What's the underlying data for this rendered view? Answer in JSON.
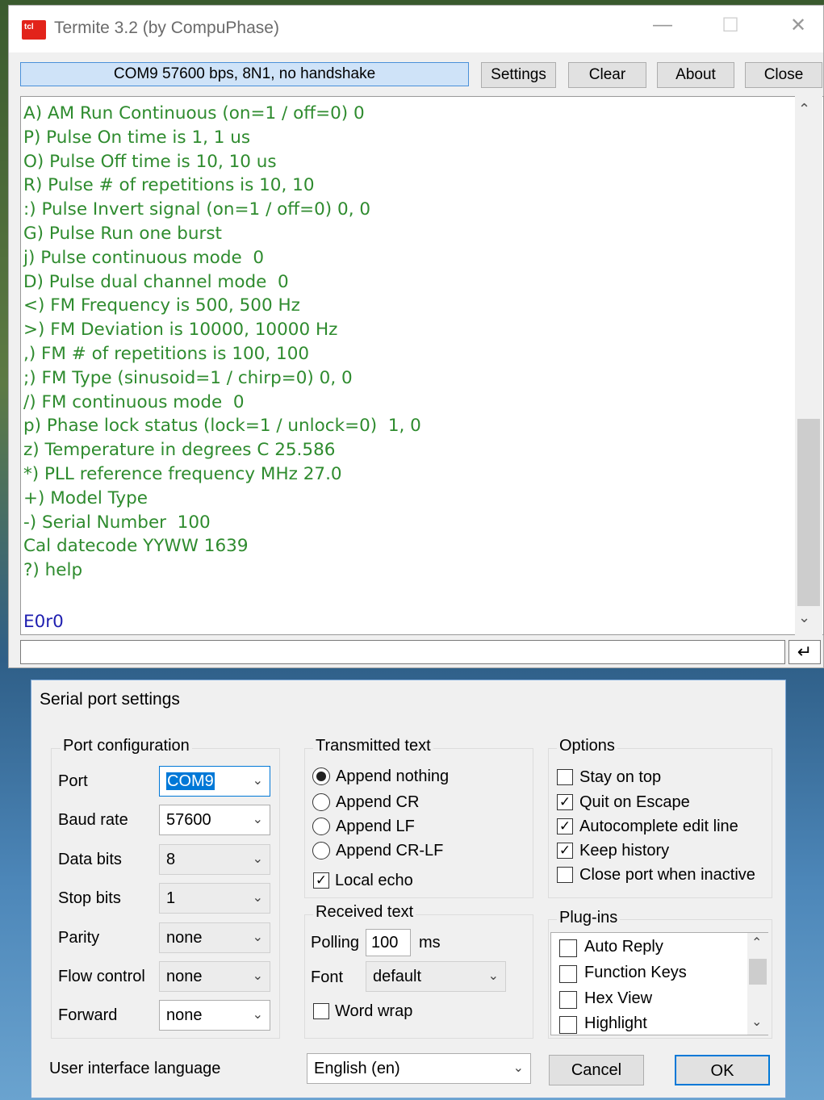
{
  "termite": {
    "title": "Termite 3.2 (by CompuPhase)",
    "app_icon_text": "tcl",
    "status": "COM9 57600 bps, 8N1, no handshake",
    "buttons": {
      "settings": "Settings",
      "clear": "Clear",
      "about": "About",
      "close": "Close"
    },
    "terminal_lines": [
      "A) AM Run Continuous (on=1 / off=0) 0",
      "P) Pulse On time is 1, 1 us",
      "O) Pulse Off time is 10, 10 us",
      "R) Pulse # of repetitions is 10, 10",
      ":) Pulse Invert signal (on=1 / off=0) 0, 0",
      "G) Pulse Run one burst",
      "j) Pulse continuous mode  0",
      "D) Pulse dual channel mode  0",
      "<) FM Frequency is 500, 500 Hz",
      ">) FM Deviation is 10000, 10000 Hz",
      ",) FM # of repetitions is 100, 100",
      ";) FM Type (sinusoid=1 / chirp=0) 0, 0",
      "/) FM continuous mode  0",
      "p) Phase lock status (lock=1 / unlock=0)  1, 0",
      "z) Temperature in degrees C 25.586",
      "*) PLL reference frequency MHz 27.0",
      "+) Model Type",
      "-) Serial Number  100",
      "Cal datecode YYWW 1639",
      "?) help"
    ],
    "echo_line": "E0r0",
    "input_value": ""
  },
  "dialog": {
    "title": "Serial port settings",
    "port_config": {
      "label": "Port configuration",
      "fields": [
        {
          "label": "Port",
          "value": "COM9",
          "enabled": true
        },
        {
          "label": "Baud rate",
          "value": "57600",
          "enabled": true
        },
        {
          "label": "Data bits",
          "value": "8",
          "enabled": false
        },
        {
          "label": "Stop bits",
          "value": "1",
          "enabled": false
        },
        {
          "label": "Parity",
          "value": "none",
          "enabled": false
        },
        {
          "label": "Flow control",
          "value": "none",
          "enabled": false
        },
        {
          "label": "Forward",
          "value": "none",
          "enabled": true
        }
      ]
    },
    "transmitted": {
      "label": "Transmitted text",
      "options": [
        "Append nothing",
        "Append CR",
        "Append LF",
        "Append CR-LF"
      ],
      "selected": "Append nothing",
      "local_echo_label": "Local echo",
      "local_echo": true
    },
    "received": {
      "label": "Received text",
      "polling_label": "Polling",
      "polling_value": "100",
      "polling_unit": "ms",
      "font_label": "Font",
      "font_value": "default",
      "word_wrap_label": "Word wrap",
      "word_wrap": false
    },
    "options": {
      "label": "Options",
      "items": [
        {
          "label": "Stay on top",
          "checked": false
        },
        {
          "label": "Quit on Escape",
          "checked": true
        },
        {
          "label": "Autocomplete edit line",
          "checked": true
        },
        {
          "label": "Keep history",
          "checked": true
        },
        {
          "label": "Close port when inactive",
          "checked": false
        }
      ]
    },
    "plugins": {
      "label": "Plug-ins",
      "items": [
        {
          "label": "Auto Reply",
          "checked": false
        },
        {
          "label": "Function Keys",
          "checked": false
        },
        {
          "label": "Hex View",
          "checked": false
        },
        {
          "label": "Highlight",
          "checked": false
        }
      ]
    },
    "language_label": "User interface language",
    "language_value": "English (en)",
    "cancel": "Cancel",
    "ok": "OK"
  }
}
